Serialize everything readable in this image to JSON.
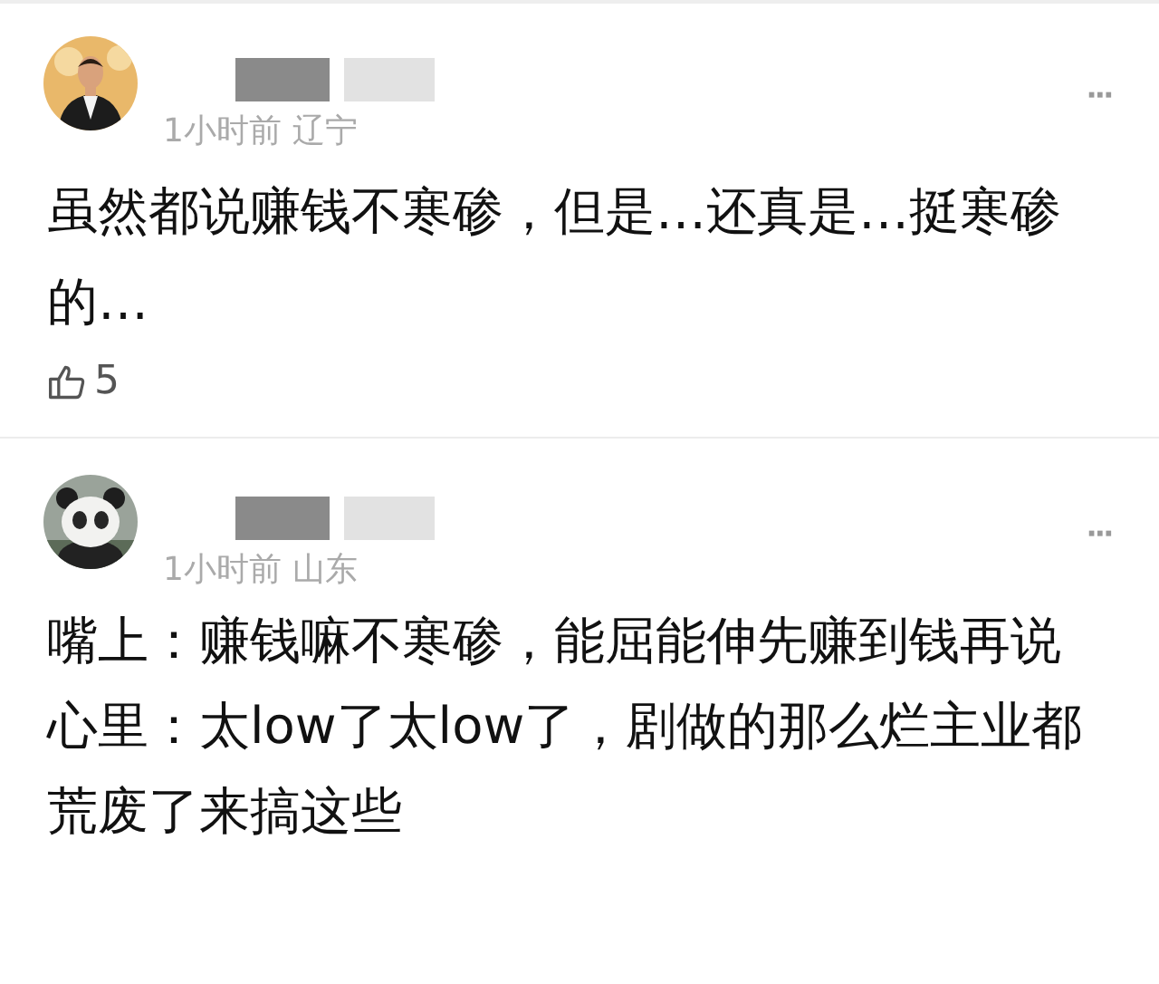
{
  "comments": [
    {
      "avatar": {
        "kind": "picture"
      },
      "name_redacted": true,
      "time": "1小时前",
      "location": "辽宁",
      "more": "···",
      "paragraphs": [
        "虽然都说赚钱不寒碜，但是…还真是…挺寒碜的…"
      ],
      "likes": "5"
    },
    {
      "avatar": {
        "kind": "picture"
      },
      "name_redacted": true,
      "time": "1小时前",
      "location": "山东",
      "more": "···",
      "paragraphs": [
        "嘴上：赚钱嘛不寒碜，能屈能伸先赚到钱再说",
        "心里：太low了太low了，剧做的那么烂主业都荒废了来搞这些"
      ]
    }
  ]
}
